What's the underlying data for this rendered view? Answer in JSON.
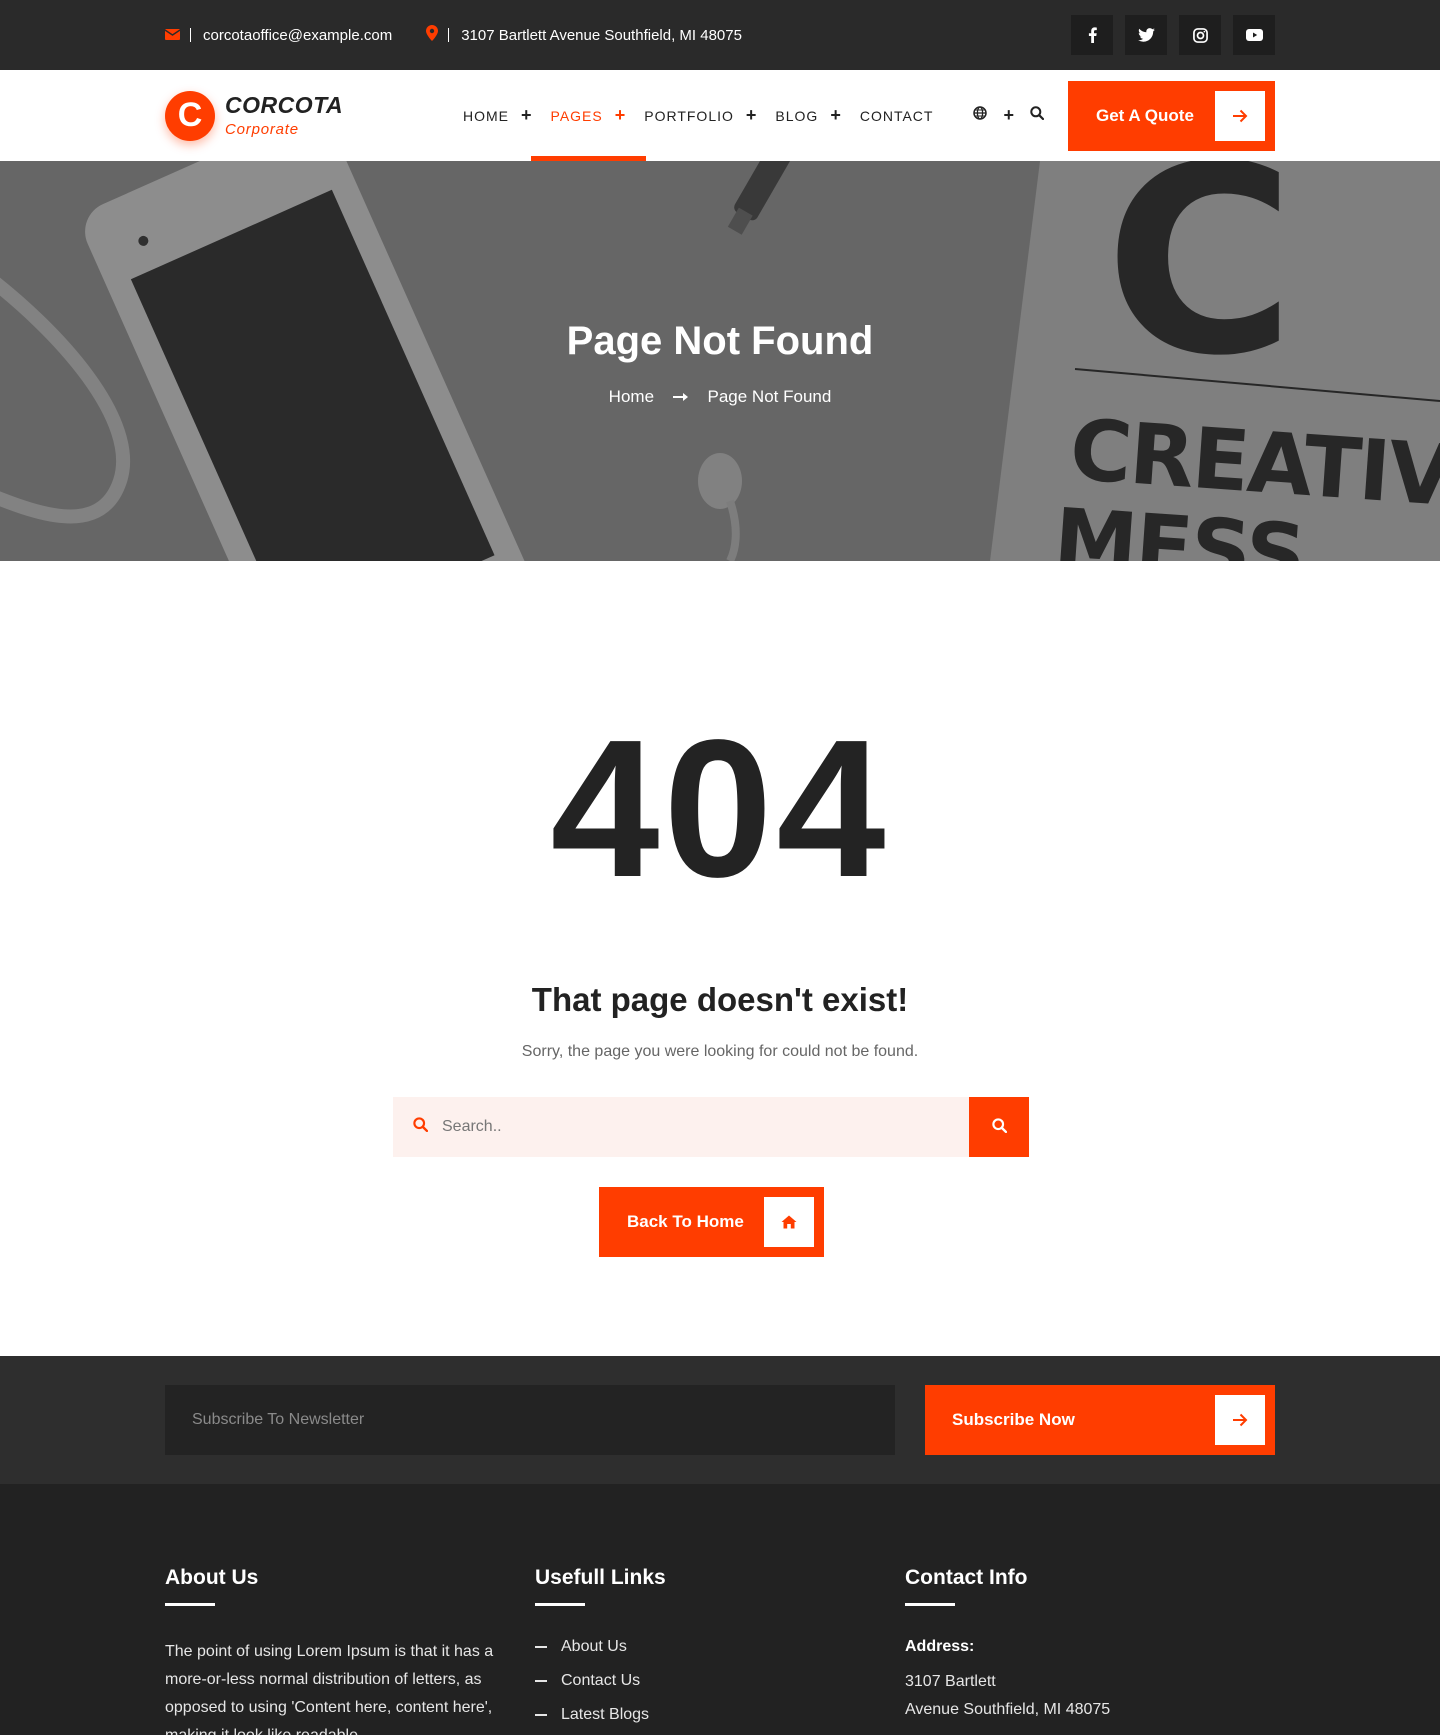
{
  "topbar": {
    "email": "corcotaoffice@example.com",
    "address": "3107 Bartlett Avenue Southfield, MI 48075",
    "socials": [
      "facebook-icon",
      "twitter-icon",
      "instagram-icon",
      "youtube-icon"
    ]
  },
  "brand": {
    "name": "CORCOTA",
    "tagline": "Corporate",
    "mark": "C",
    "accent": "#ff3d00"
  },
  "nav": {
    "items": [
      {
        "label": "HOME",
        "has_sub": true
      },
      {
        "label": "PAGES",
        "has_sub": true,
        "active": true
      },
      {
        "label": "PORTFOLIO",
        "has_sub": true
      },
      {
        "label": "BLOG",
        "has_sub": true
      },
      {
        "label": "CONTACT",
        "has_sub": false
      }
    ],
    "quote_label": "Get A Quote"
  },
  "hero": {
    "title": "Page Not Found",
    "breadcrumb_home": "Home",
    "breadcrumb_current": "Page Not Found",
    "bg_text_top": "C",
    "bg_text_mid": "CREATIVE",
    "bg_text_bottom": "MESS"
  },
  "error": {
    "code": "404",
    "headline": "That page doesn't exist!",
    "message": "Sorry, the page you were looking for could not be found.",
    "search_placeholder": "Search..",
    "back_label": "Back To Home"
  },
  "newsletter": {
    "placeholder": "Subscribe To Newsletter",
    "button_label": "Subscribe Now"
  },
  "footer": {
    "about_title": "About Us",
    "about_text": "The point of using Lorem Ipsum is that it has a more-or-less normal distribution of letters, as opposed to using 'Content here, content here', making it look like readable",
    "links_title": "Usefull Links",
    "links": [
      "About Us",
      "Contact Us",
      "Latest Blogs"
    ],
    "contact_title": "Contact Info",
    "address_label": "Address:",
    "address_line1": "3107 Bartlett",
    "address_line2": "Avenue Southfield, MI 48075"
  }
}
